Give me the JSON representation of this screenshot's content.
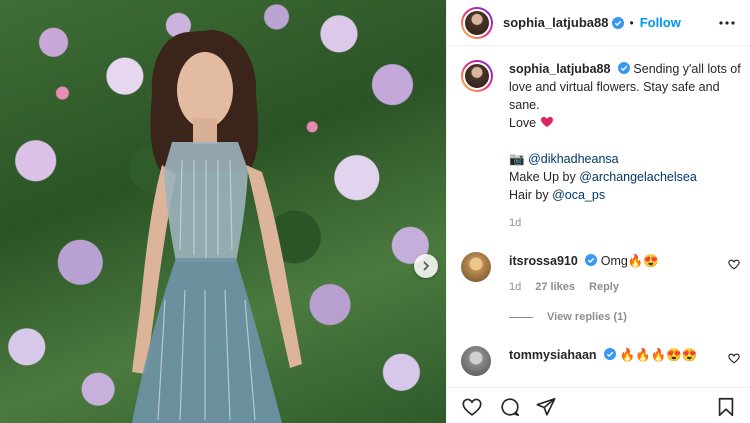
{
  "post": {
    "username": "sophia_latjuba88",
    "follow_label": "Follow",
    "separator": "•"
  },
  "caption": {
    "username": "sophia_latjuba88",
    "text": "Sending y'all lots of love and virtual flowers. Stay safe and sane.",
    "love_line": "Love",
    "camera_mention": "@dikhadheansa",
    "makeup_label": "Make Up by",
    "makeup_mention": "@archangelachelsea",
    "hair_label": "Hair by",
    "hair_mention": "@oca_ps",
    "time": "1d"
  },
  "comments": [
    {
      "username": "itsrossa910",
      "text": "Omg🔥😍",
      "time": "1d",
      "likes": "27 likes",
      "reply_label": "Reply",
      "view_replies": "View replies (1)"
    },
    {
      "username": "tommysiahaan",
      "text": "🔥🔥🔥😍😍"
    }
  ],
  "colors": {
    "link": "#00376b",
    "follow": "#0095f6",
    "verified": "#3897f0",
    "love_heart": "#e0245e",
    "secondary_text": "#8e8e8e"
  },
  "icons": [
    "verified-badge-icon",
    "more-options-icon",
    "heart-icon",
    "comment-icon",
    "share-icon",
    "bookmark-icon",
    "chevron-right-icon",
    "camera-emoji-icon"
  ]
}
